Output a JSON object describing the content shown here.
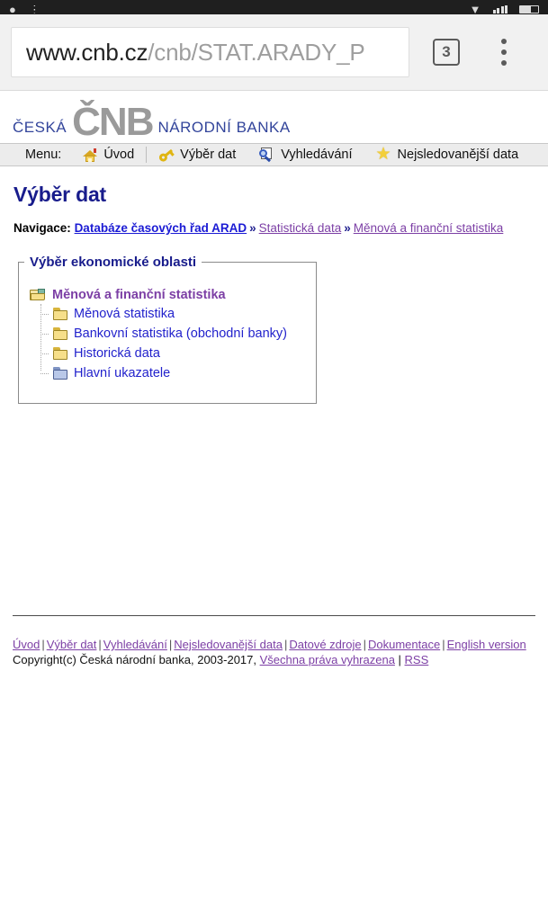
{
  "status_bar": {
    "left_icons": [
      "camera-icon",
      "info-icon"
    ],
    "right_icons": [
      "wifi-icon",
      "signal-bars-icon",
      "battery-icon"
    ]
  },
  "browser": {
    "url_host": "www.cnb.cz",
    "url_path": "/cnb/STAT.ARADY_P",
    "url_full": "www.cnb.cz/cnb/STAT.ARADY_P",
    "tab_count": "3",
    "overflow_menu": "menu-icon"
  },
  "logo": {
    "left": "ČESKÁ",
    "mark": "ČNB",
    "right": "NÁRODNÍ BANKA"
  },
  "menu": {
    "label": "Menu:",
    "items": [
      {
        "label": "Úvod",
        "icon": "home-icon"
      },
      {
        "label": "Výběr dat",
        "icon": "key-icon"
      },
      {
        "label": "Vyhledávání",
        "icon": "search-icon"
      },
      {
        "label": "Nejsledovanější data",
        "icon": "star-icon"
      }
    ]
  },
  "page": {
    "title": "Výběr dat"
  },
  "breadcrumb": {
    "label": "Navigace:",
    "separator": "»",
    "items": [
      {
        "label": "Databáze časových řad ARAD",
        "state": "primary"
      },
      {
        "label": "Statistická data",
        "state": "visited"
      },
      {
        "label": "Měnová a finanční statistika",
        "state": "visited"
      }
    ]
  },
  "area_selector": {
    "legend": "Výběr ekonomické oblasti",
    "root": {
      "label": "Měnová a finanční statistika",
      "icon": "folder-open-icon"
    },
    "children": [
      {
        "label": "Měnová statistika",
        "icon": "folder-icon"
      },
      {
        "label": "Bankovní statistika (obchodní banky)",
        "icon": "folder-icon"
      },
      {
        "label": "Historická data",
        "icon": "folder-icon"
      },
      {
        "label": "Hlavní ukazatele",
        "icon": "folder-blue-icon"
      }
    ]
  },
  "footer": {
    "links": [
      "Úvod",
      "Výběr dat",
      "Vyhledávání",
      "Nejsledovanější data",
      "Datové zdroje",
      "Dokumentace",
      "English version"
    ],
    "separator": "|",
    "copyright_prefix": "Copyright(c) Česká národní banka, 2003-2017, ",
    "rights_link": "Všechna práva vyhrazena",
    "rss_link": "RSS"
  },
  "colors": {
    "brand_blue": "#33459b",
    "heading_navy": "#181c8c",
    "link_blue": "#2222cc",
    "link_visited": "#7c3fa5",
    "menu_bg": "#ececec",
    "toolbar_bg": "#f1f1f1"
  }
}
